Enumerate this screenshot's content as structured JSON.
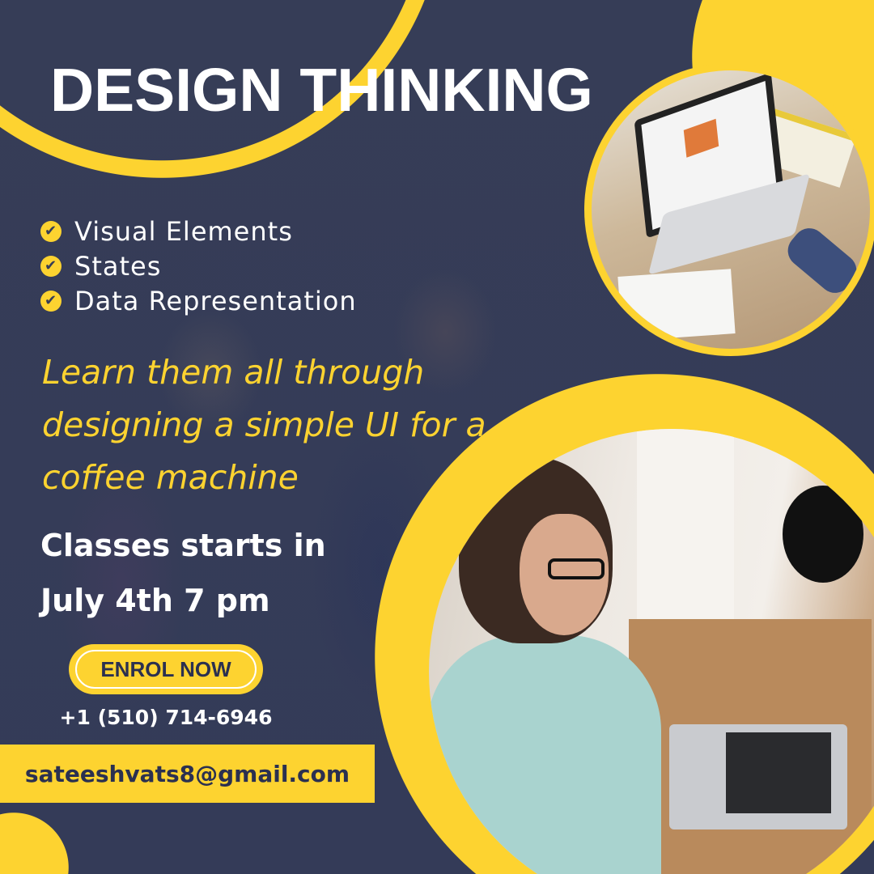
{
  "colors": {
    "background": "#363d57",
    "accent": "#fdd330",
    "text_dark": "#2b3050"
  },
  "title": "DESIGN THINKING",
  "bullets": [
    {
      "icon": "check-circle-icon",
      "label": "Visual Elements"
    },
    {
      "icon": "check-circle-icon",
      "label": "States"
    },
    {
      "icon": "check-circle-icon",
      "label": "Data Representation"
    }
  ],
  "tagline": "Learn them all through designing a simple UI for a coffee machine",
  "schedule": {
    "line1": "Classes starts in",
    "line2": "July 4th 7 pm"
  },
  "cta": {
    "label": "ENROL NOW"
  },
  "contact": {
    "phone": "+1 (510) 714-6946",
    "email": "sateeshvats8@gmail.com"
  },
  "check_glyph": "✔"
}
